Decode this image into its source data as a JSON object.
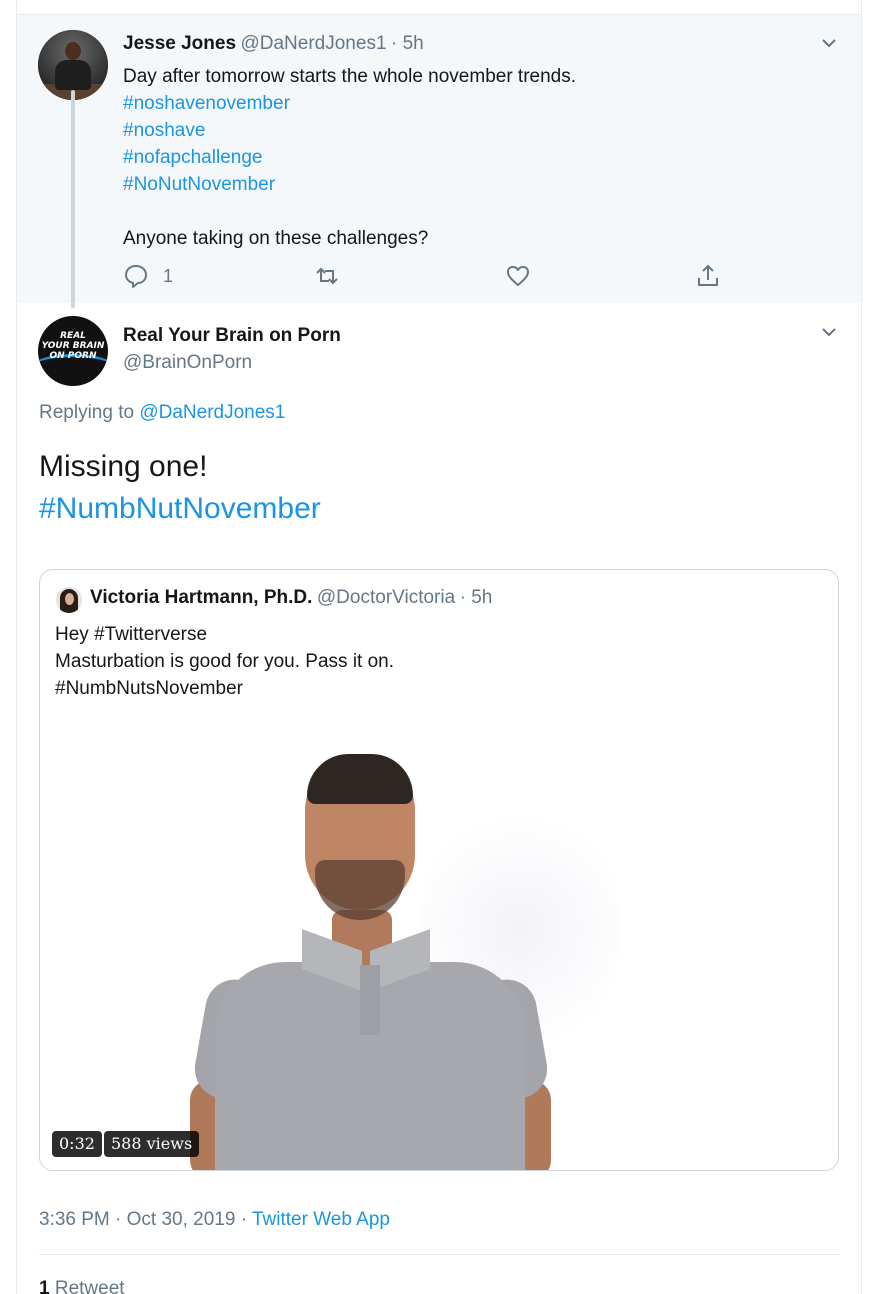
{
  "parent_tweet": {
    "name": "Jesse Jones",
    "handle": "@DaNerdJones1",
    "time": "· 5h",
    "lines": [
      "Day after tomorrow starts the whole november trends.",
      "#noshavenovember",
      "#noshave",
      "#nofapchallenge",
      "#NoNutNovember",
      "",
      "Anyone taking on these challenges?"
    ],
    "reply_count": "1"
  },
  "main_tweet": {
    "name": "Real Your Brain on Porn",
    "handle": "@BrainOnPorn",
    "avatar_text": [
      "REAL",
      "YOUR BRAIN",
      "ON PORN"
    ],
    "replying_prefix": "Replying to",
    "replying_to": "@DaNerdJones1",
    "text_line1": "Missing one!",
    "hashtag": "#NumbNutNovember",
    "timestamp": "3:36 PM · Oct 30, 2019 · ",
    "source": "Twitter Web App",
    "retweet_count": "1",
    "retweet_label": "Retweet"
  },
  "quoted_tweet": {
    "name": "Victoria Hartmann, Ph.D.",
    "handle": "@DoctorVictoria",
    "time": "· 5h",
    "lines": [
      "Hey #Twitterverse",
      "Masturbation is good for you. Pass it on.",
      "#NumbNutsNovember"
    ],
    "video_duration": "0:32",
    "video_views": "588 views"
  },
  "icons": [
    "chevron-down-icon",
    "reply-icon",
    "retweet-icon",
    "like-icon",
    "share-icon"
  ],
  "colors": {
    "link": "#1b95e0",
    "muted": "#657786",
    "text": "#14171a",
    "parent_bg": "#f5f8fa"
  }
}
